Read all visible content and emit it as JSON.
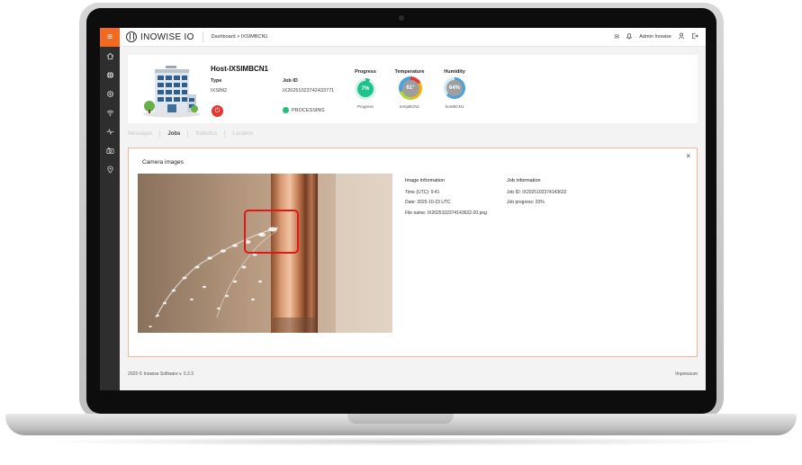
{
  "app": {
    "logo_text": "INOWISE IO",
    "breadcrumb": "Dashboard > IXSIMBCN1"
  },
  "topbar": {
    "user_name": "Admin Inowise",
    "icons": [
      "mail-icon",
      "bell-icon",
      "user-icon",
      "logout-icon"
    ]
  },
  "sidebar": {
    "items": [
      "home-icon",
      "globe-icon",
      "gear-icon",
      "wifi-icon",
      "pulse-icon",
      "camera-icon",
      "location-pin-icon"
    ]
  },
  "host": {
    "title": "Host-IXSIMBCN1",
    "type_label": "Type",
    "type_value": "IXSIM2",
    "job_label": "Job ID",
    "job_value": "IX20251023742433771",
    "status": "PROCESSING"
  },
  "metrics": {
    "progress": {
      "title": "Progress",
      "value": "7%",
      "sub": "Progress",
      "percent": 7,
      "color": "#1fc18c"
    },
    "temperature": {
      "title": "Temperature",
      "value": "61°",
      "sub": "tempBCN1",
      "color": "#9e9e9e"
    },
    "humidity": {
      "title": "Humidity",
      "value": "64%",
      "sub": "humBCN1",
      "color": "#9e9e9e"
    }
  },
  "tabs": [
    "Messages",
    "Jobs",
    "Statistics",
    "Location"
  ],
  "active_tab": "Jobs",
  "panel": {
    "title": "Camera images",
    "close_label": "×",
    "image_info": {
      "heading": "Image information",
      "time": "Time (UTC): 9:41",
      "date": "Date: 2025-10-23 UTC",
      "file": "File name: IX2025102374143622-20.png"
    },
    "job_info": {
      "heading": "Job information",
      "job_id": "Job ID: IX2025102374143622",
      "progress": "Job progress: 20%"
    }
  },
  "footer": {
    "copyright": "2025 © Inowise Software v. 5.2.3",
    "impressum": "Impressum"
  },
  "colors": {
    "accent": "#f26a21",
    "sidebar": "#2e2e2e",
    "highlight": "#e01818",
    "status_ok": "#20c07a"
  }
}
